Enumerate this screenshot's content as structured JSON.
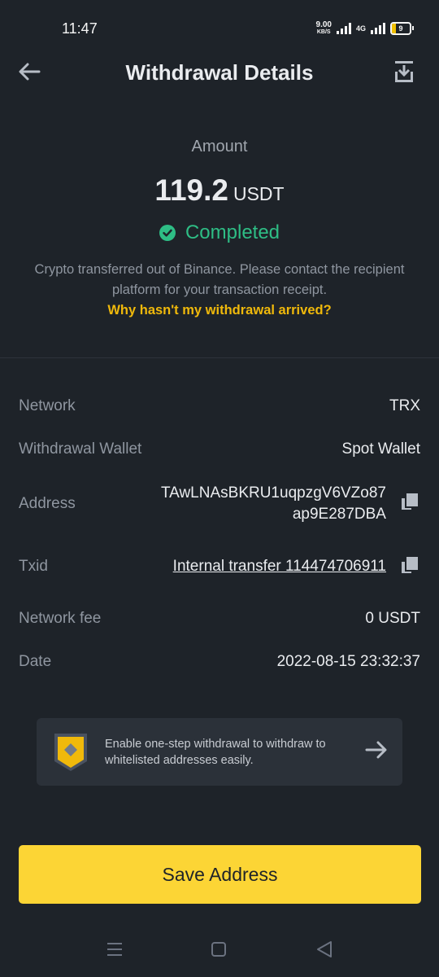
{
  "status_bar": {
    "time": "11:47",
    "speed_value": "9.00",
    "speed_unit": "KB/S",
    "network": "4G",
    "battery": "9"
  },
  "header": {
    "title": "Withdrawal Details",
    "back_icon": "arrow-left-icon",
    "action_icon": "download-icon"
  },
  "summary": {
    "amount_label": "Amount",
    "amount_value": "119.2",
    "amount_unit": "USDT",
    "status": "Completed",
    "status_color": "#2ebd85",
    "note": "Crypto transferred out of Binance. Please contact the recipient platform for your transaction receipt.",
    "help_link": "Why hasn't my withdrawal arrived?"
  },
  "details": {
    "network_label": "Network",
    "network_value": "TRX",
    "wallet_label": "Withdrawal Wallet",
    "wallet_value": "Spot Wallet",
    "address_label": "Address",
    "address_line1": "TAwLNAsBKRU1uqpzgV6VZo87",
    "address_line2": "ap9E287DBA",
    "txid_label": "Txid",
    "txid_value": "Internal transfer 114474706911",
    "fee_label": "Network fee",
    "fee_value": "0 USDT",
    "date_label": "Date",
    "date_value": "2022-08-15 23:32:37"
  },
  "promo": {
    "text": "Enable one-step withdrawal to withdraw to whitelisted addresses easily."
  },
  "actions": {
    "save_label": "Save Address"
  },
  "colors": {
    "accent": "#fcd535",
    "link": "#f0b90b",
    "background": "#1e2329"
  }
}
